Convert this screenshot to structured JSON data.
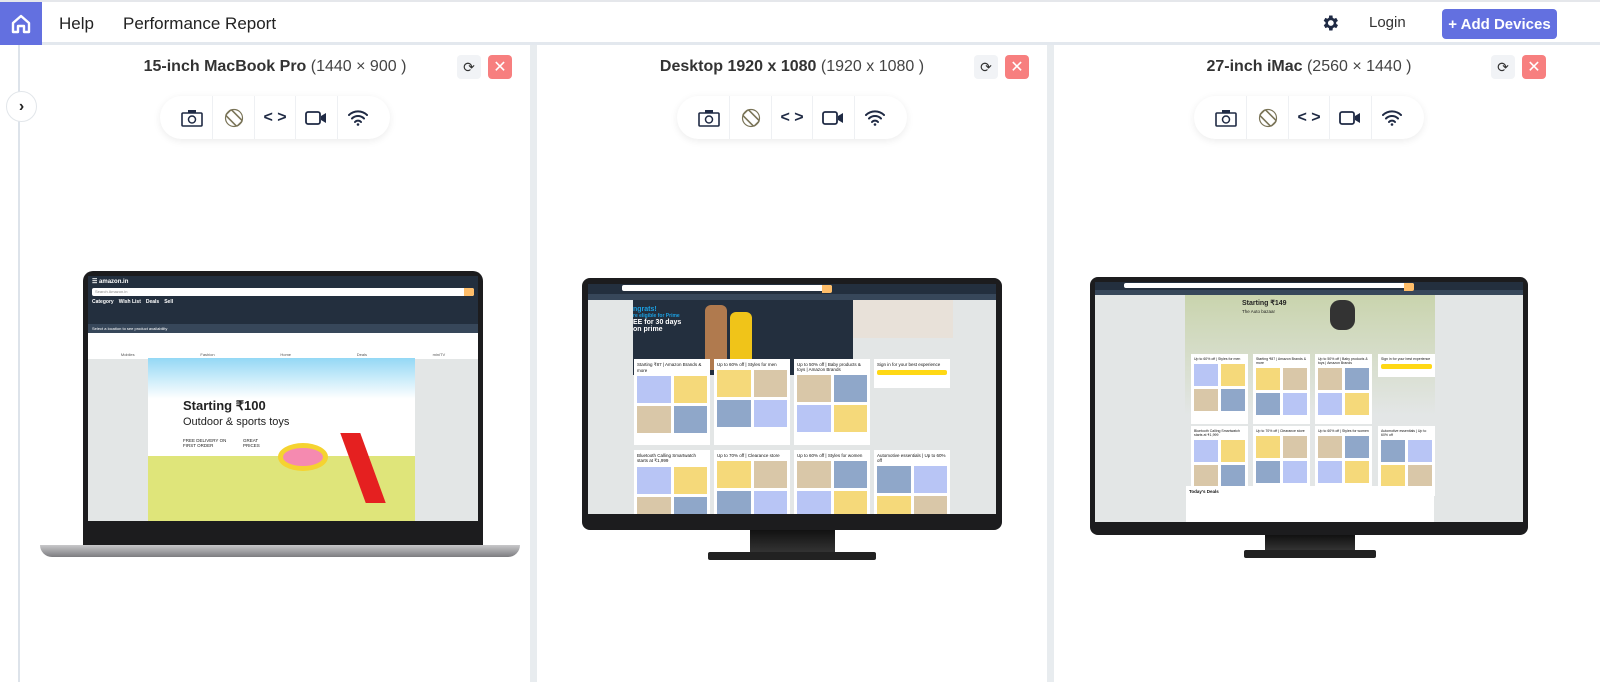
{
  "header": {
    "nav": [
      "Help",
      "Performance Report"
    ],
    "login": "Login",
    "add_devices": "+ Add Devices",
    "accent": "#6370e0"
  },
  "devices": [
    {
      "name": "15-inch MacBook Pro",
      "resolution": "(1440 × 900 )",
      "screen": {
        "search_placeholder": "Search Amazon.in",
        "nav": [
          "Category",
          "Wish List",
          "Deals",
          "Sell"
        ],
        "location": "Select a location to see product availability",
        "categories": [
          "Mobiles",
          "Fashion",
          "Home",
          "Deals",
          "miniTV"
        ],
        "banner_title": "Starting ₹100",
        "banner_subtitle": "Outdoor & sports toys",
        "badge1": "FREE DELIVERY ON FIRST ORDER",
        "badge2": "GREAT PRICES"
      }
    },
    {
      "name": "Desktop 1920 x 1080",
      "resolution": "(1920 x 1080 )",
      "screen": {
        "hero": [
          "ngrats!",
          "re eligible for Prime",
          "EE for 30 days",
          "on prime"
        ],
        "cards": [
          "Starting ₹87 | Amazon Brands & more",
          "Up to 60% off | Styles for men",
          "Up to 50% off | Baby products & toys | Amazon Brands",
          "Sign in for your best experience",
          "Bluetooth Calling Smartwatch starts at ₹1,999",
          "Up to 70% off | Clearance store",
          "Up to 60% off | Styles for women",
          "Automotive essentials | Up to 60% off"
        ]
      }
    },
    {
      "name": "27-inch iMac",
      "resolution": "(2560 × 1440 )",
      "screen": {
        "hero_title": "Starting ₹149",
        "hero_subtitle": "The Auto bazaar",
        "cards": [
          "Up to 60% off | Styles for men",
          "Starting ₹87 | Amazon Brands & more",
          "Up to 50% off | Baby products & toys | Amazon Brands",
          "Sign in for your best experience",
          "Bluetooth Calling Smartwatch starts at ₹1,999",
          "Up to 70% off | Clearance store",
          "Up to 60% off | Styles for women",
          "Automotive essentials | Up to 60% off"
        ],
        "deals": "Today's Deals"
      }
    }
  ],
  "toolbar_icons": [
    "camera-icon",
    "rotate-icon",
    "code-icon",
    "video-icon",
    "wifi-icon"
  ]
}
